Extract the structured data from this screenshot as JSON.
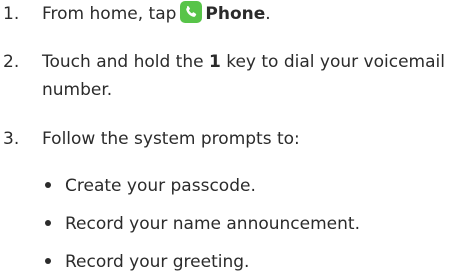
{
  "steps": [
    {
      "number": "1.",
      "prefix": "From home, tap",
      "icon": "phone-icon",
      "bold": "Phone",
      "suffix": "."
    },
    {
      "number": "2.",
      "line1_before": "Touch and hold the",
      "bold": "1",
      "line1_after": "key to dial your voicemail",
      "line2": "number."
    },
    {
      "number": "3.",
      "text": "Follow the system prompts to:"
    }
  ],
  "bullets": [
    "Create your passcode.",
    "Record your name announcement.",
    "Record your greeting."
  ],
  "colors": {
    "text": "#2b2b2b",
    "phone_icon_bg": "#58c449"
  }
}
